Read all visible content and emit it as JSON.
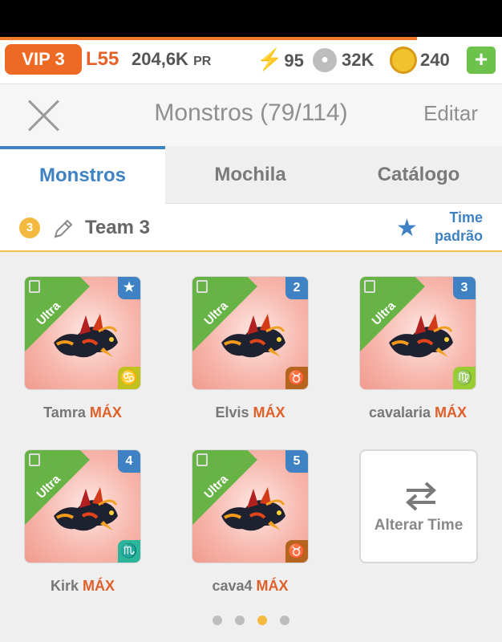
{
  "resources": {
    "vip_label": "VIP 3",
    "level": "L55",
    "power": "204,6K",
    "power_unit": "PR",
    "energy": "95",
    "food": "32K",
    "gold": "240",
    "plus": "+",
    "progress_fraction": 0.83
  },
  "header": {
    "title": "Monstros (79/114)",
    "edit_label": "Editar"
  },
  "tabs": [
    {
      "label": "Monstros",
      "active": true
    },
    {
      "label": "Mochila",
      "active": false
    },
    {
      "label": "Catálogo",
      "active": false
    }
  ],
  "team": {
    "number": "3",
    "name": "Team 3",
    "default_label_line1": "Time",
    "default_label_line2": "padrão"
  },
  "monsters": [
    {
      "name": "Tamra",
      "suffix": "MÁX",
      "rank": "Ultra",
      "slot": "★",
      "zodiac": "♋",
      "zodiac_color": "#c2c21e"
    },
    {
      "name": "Elvis",
      "suffix": "MÁX",
      "rank": "Ultra",
      "slot": "2",
      "zodiac": "♉",
      "zodiac_color": "#b5651d"
    },
    {
      "name": "cavalaria",
      "suffix": "MÁX",
      "rank": "Ultra",
      "slot": "3",
      "zodiac": "♍",
      "zodiac_color": "#9acd32"
    },
    {
      "name": "Kirk",
      "suffix": "MÁX",
      "rank": "Ultra",
      "slot": "4",
      "zodiac": "♏",
      "zodiac_color": "#2bb59a"
    },
    {
      "name": "cava4",
      "suffix": "MÁX",
      "rank": "Ultra",
      "slot": "5",
      "zodiac": "♉",
      "zodiac_color": "#b5651d"
    }
  ],
  "swap": {
    "label": "Alterar Time"
  },
  "pagination": {
    "total": 4,
    "active": 3
  },
  "colors": {
    "accent_blue": "#3f82c4",
    "orange": "#ee6a24",
    "ultra_green": "#67b346",
    "max_orange": "#e0602a"
  }
}
